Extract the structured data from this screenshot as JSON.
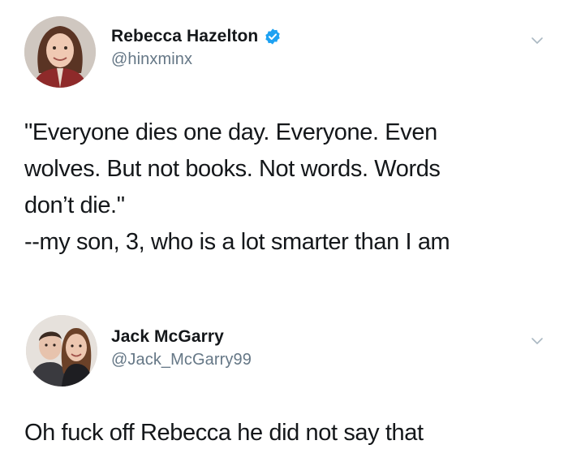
{
  "tweets": [
    {
      "author": {
        "display_name": "Rebecca Hazelton",
        "handle": "@hinxminx",
        "verified": true
      },
      "avatar_icon": "profile-photo-woman",
      "menu_icon": "chevron-down-icon",
      "text_lines": [
        "\"Everyone dies one day. Everyone. Even",
        "wolves. But not books. Not words. Words",
        "don’t die.\"",
        "--my son, 3, who is a lot smarter than I am"
      ]
    },
    {
      "author": {
        "display_name": "Jack McGarry",
        "handle": "@Jack_McGarry99",
        "verified": false
      },
      "avatar_icon": "profile-photo-couple",
      "menu_icon": "chevron-down-icon",
      "text_lines": [
        "Oh fuck off Rebecca he did not say that"
      ]
    }
  ],
  "colors": {
    "text_primary": "#14171a",
    "text_secondary": "#657786",
    "verified_blue": "#1da1f2",
    "chevron": "#aab8c2"
  }
}
